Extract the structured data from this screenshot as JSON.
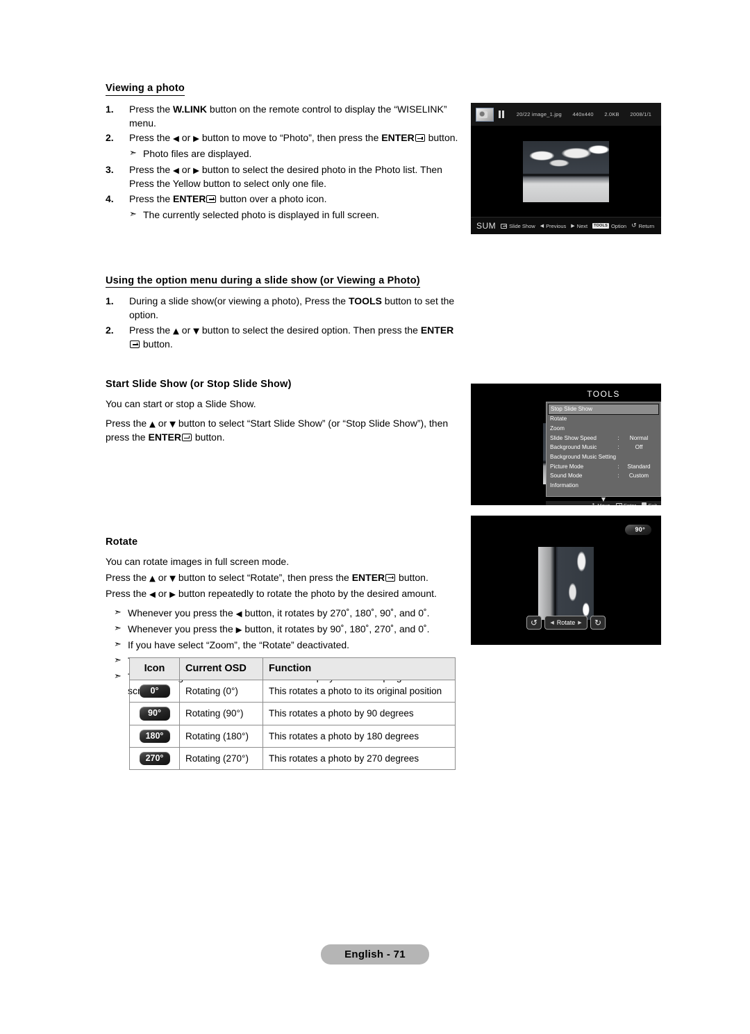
{
  "document": {
    "footer_label": "English - 71"
  },
  "sections": [
    {
      "heading": "Viewing a photo",
      "steps": [
        {
          "num": "1.",
          "parts": [
            {
              "t": "Press the "
            },
            {
              "t": "W.LINK",
              "b": true
            },
            {
              "t": " button on the remote control to display the “WISELINK” menu."
            }
          ]
        },
        {
          "num": "2.",
          "parts": [
            {
              "t": "Press the "
            },
            {
              "t": "◀",
              "glyph": true
            },
            {
              "t": " or "
            },
            {
              "t": "▶",
              "glyph": true
            },
            {
              "t": " button to move to “Photo”, then press the "
            },
            {
              "t": "ENTER",
              "b": true
            },
            {
              "icon": "enter"
            },
            {
              "t": " button."
            }
          ]
        }
      ],
      "note_after_step2": "Photo files are displayed.",
      "steps2": [
        {
          "num": "3.",
          "parts": [
            {
              "t": "Press the "
            },
            {
              "t": "◀",
              "glyph": true
            },
            {
              "t": " or "
            },
            {
              "t": "▶",
              "glyph": true
            },
            {
              "t": " button to select the desired photo in the Photo list. Then Press the Yellow button to select only one file."
            }
          ]
        },
        {
          "num": "4.",
          "parts": [
            {
              "t": "Press the "
            },
            {
              "t": "ENTER",
              "b": true
            },
            {
              "icon": "enter"
            },
            {
              "t": " button over a photo icon."
            }
          ]
        }
      ],
      "note_after_step4": "The currently selected photo is displayed in full screen."
    },
    {
      "heading": "Using the option menu during a slide show (or Viewing a Photo)",
      "steps": [
        {
          "num": "1.",
          "parts": [
            {
              "t": "During a slide show(or viewing a photo), Press the "
            },
            {
              "t": "TOOLS",
              "b": true
            },
            {
              "t": " button to set the option."
            }
          ]
        },
        {
          "num": "2.",
          "parts": [
            {
              "t": "Press the "
            },
            {
              "t": "▲",
              "glyph": true
            },
            {
              "t": " or "
            },
            {
              "t": "▼",
              "glyph": true
            },
            {
              "t": " button to select the desired option. Then press the "
            },
            {
              "t": "ENTER",
              "b": true
            },
            {
              "icon": "enter"
            },
            {
              "t": " button."
            }
          ]
        }
      ]
    }
  ],
  "slideshow_block": {
    "heading": "Start Slide Show (or Stop Slide Show)",
    "para1": "You can start or stop a Slide Show.",
    "para2_parts": [
      {
        "t": "Press the "
      },
      {
        "t": "▲",
        "glyph": true
      },
      {
        "t": " or "
      },
      {
        "t": "▼",
        "glyph": true
      },
      {
        "t": " button to select “Start Slide Show” (or “Stop Slide Show”), then press the "
      },
      {
        "t": "ENTER",
        "b": true
      },
      {
        "icon": "enter"
      },
      {
        "t": " button."
      }
    ]
  },
  "rotate_block": {
    "heading": "Rotate",
    "para1": "You can rotate images in full screen mode.",
    "para2_parts": [
      {
        "t": "Press the "
      },
      {
        "t": "▲",
        "glyph": true
      },
      {
        "t": " or "
      },
      {
        "t": "▼",
        "glyph": true
      },
      {
        "t": " button to select “Rotate”, then press the "
      },
      {
        "t": "ENTER",
        "b": true
      },
      {
        "icon": "enter"
      },
      {
        "t": " button."
      }
    ],
    "para3_parts": [
      {
        "t": "Press the "
      },
      {
        "t": "◀",
        "glyph": true
      },
      {
        "t": " or "
      },
      {
        "t": "▶",
        "glyph": true
      },
      {
        "t": " button repeatedly to rotate the photo by the desired amount."
      }
    ],
    "notes": [
      {
        "parts": [
          {
            "t": "Whenever you press the "
          },
          {
            "t": "◀",
            "glyph": true
          },
          {
            "t": " button, it rotates by 270˚, 180˚, 90˚, and 0˚."
          }
        ]
      },
      {
        "parts": [
          {
            "t": "Whenever you press the "
          },
          {
            "t": "▶",
            "glyph": true
          },
          {
            "t": " button, it rotates by 90˚, 180˚, 270˚, and 0˚."
          }
        ]
      },
      {
        "parts": [
          {
            "t": "If you have select “Zoom”, the “Rotate” deactivated."
          }
        ]
      },
      {
        "parts": [
          {
            "t": "The rotated file is not saved."
          }
        ]
      },
      {
        "parts": [
          {
            "t": "The Rotating function information icon is displayed at the top right of the screen"
          }
        ]
      }
    ]
  },
  "rotate_table": {
    "headers": [
      "Icon",
      "Current OSD",
      "Function"
    ],
    "rows": [
      {
        "icon": "0°",
        "osd": "Rotating (0°)",
        "function": "This rotates a photo to its original position"
      },
      {
        "icon": "90°",
        "osd": "Rotating (90°)",
        "function": "This rotates a photo by 90 degrees"
      },
      {
        "icon": "180°",
        "osd": "Rotating (180°)",
        "function": "This rotates a photo by 180 degrees"
      },
      {
        "icon": "270°",
        "osd": "Rotating (270°)",
        "function": "This rotates a photo by 270 degrees"
      }
    ]
  },
  "screenshots": {
    "photo_viewer": {
      "meta": [
        "20/22 image_1.jpg",
        "440x440",
        "2.0KB",
        "2008/1/1"
      ],
      "footer_sum": "SUM",
      "footer_hints": [
        "Slide Show",
        "Previous",
        "Next",
        "Option",
        "Return"
      ],
      "footer_tools_badge": "TOOLS",
      "prev_glyph": "◀",
      "next_glyph": "▶"
    },
    "tools_menu": {
      "title": "TOOLS",
      "items": [
        {
          "label": "Stop Slide Show",
          "colon": "",
          "value": "",
          "selected": true
        },
        {
          "label": "Rotate",
          "colon": "",
          "value": ""
        },
        {
          "label": "Zoom",
          "colon": "",
          "value": ""
        },
        {
          "label": "Slide Show Speed",
          "colon": ":",
          "value": "Normal"
        },
        {
          "label": "Background Music",
          "colon": ":",
          "value": "Off"
        },
        {
          "label": "Background Music Setting",
          "colon": "",
          "value": ""
        },
        {
          "label": "Picture Mode",
          "colon": ":",
          "value": "Standard"
        },
        {
          "label": "Sound Mode",
          "colon": ":",
          "value": "Custom"
        },
        {
          "label": "Information",
          "colon": "",
          "value": ""
        }
      ],
      "footer": [
        "Move",
        "Enter",
        "Exit"
      ]
    },
    "rotate_view": {
      "badge": "90°",
      "control_label": "Rotate",
      "left_glyph": "↺",
      "right_glyph": "↻",
      "prev_arrow": "◀",
      "next_arrow": "▶"
    }
  }
}
